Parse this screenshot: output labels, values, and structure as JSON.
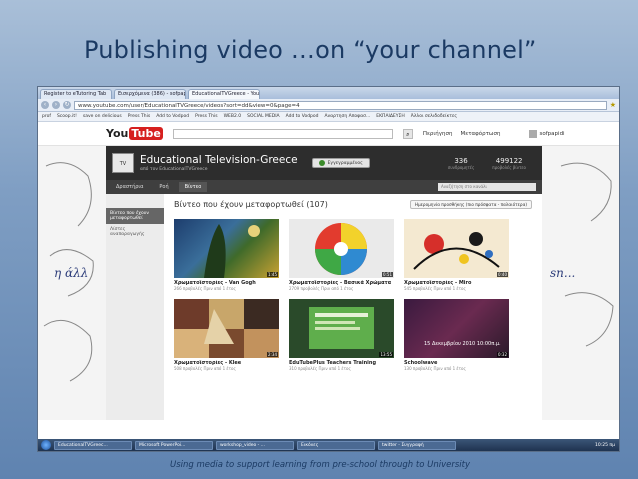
{
  "slide": {
    "title": "Publishing video …on “your channel”",
    "footer": "Using media to support learning from pre-school through to University"
  },
  "browser": {
    "tabs": [
      "Register to eTutoring Tab",
      "Εισερχόμενα (386) - sofpapi",
      "EducationalTVGreece - You"
    ],
    "url": "www.youtube.com/user/EducationalTVGreece/videos?sort=dd&view=0&page=4",
    "bookmarks": [
      "prof",
      "Scoop.it!",
      "save on delicious",
      "Press This",
      "Add to Vodpod",
      "Press This",
      "WEB2.0",
      "SOCIAL MEDIA",
      "Add to Vodpod",
      "Αναρτηση Αποφασ...",
      "ΕΚΠΑΙΔΕΥΣΗ",
      "Άλλοι σελιδοδείκτες"
    ]
  },
  "youtube": {
    "logo_you": "You",
    "logo_tube": "Tube",
    "links": [
      "Περιήγηση",
      "Μεταφόρτωση"
    ],
    "user": "sofpapidi"
  },
  "channel": {
    "name": "Educational Television-Greece",
    "subtitle": "από τον EducationalTVGreece",
    "subscribe_label": "Εγγεγραμμένος",
    "stats": [
      {
        "value": "336",
        "label": "συνδρομητές"
      },
      {
        "value": "499122",
        "label": "προβολές βίντεο"
      }
    ],
    "tabs": [
      "Δραστήρια",
      "Ροή",
      "Βίντεο"
    ],
    "active_tab": "Βίντεο",
    "search_placeholder": "Αναζήτηση στο κανάλι"
  },
  "sidebar": {
    "items": [
      "Βίντεο που έχουν μεταφορτωθεί",
      "Λίστες αναπαραγωγής"
    ]
  },
  "main": {
    "title": "Βίντεο που έχουν μεταφορτωθεί (107)",
    "sort_label": "Ημερομηνία προσθήκης (πιο πρόσφατα - παλαιότερα)"
  },
  "videos": [
    {
      "title": "Χρωματοϊστορίες - Van Gogh",
      "meta": "266 προβολές Πριν από 1 έτος",
      "duration": "1:45"
    },
    {
      "title": "Χρωματοϊστορίες - Βασικά Χρώματα",
      "meta": "2709 προβολές Πριν από 1 έτος",
      "duration": "0:51"
    },
    {
      "title": "Χρωματοϊστορίες - Miro",
      "meta": "545 προβολές Πριν από 1 έτος",
      "duration": "0:40"
    },
    {
      "title": "Χρωματοϊστορίες - Klee",
      "meta": "508 προβολές Πριν από 1 έτος",
      "duration": "2:34"
    },
    {
      "title": "EduTubePlus Teachers Training",
      "meta": "310 προβολές Πριν από 1 έτος",
      "duration": "13:55"
    },
    {
      "title": "Schoolwave",
      "meta": "130 προβολές Πριν από 1 έτος",
      "duration": "0:32",
      "overlay": "15 Δεκεμβρίου 2010 10:00π.μ."
    }
  ],
  "doodles": {
    "left": "η άλλ",
    "right": "sn..."
  },
  "taskbar": {
    "items": [
      "EducationalTVGreec...",
      "Microsoft PowerPoi...",
      "workshop_video - ...",
      "Εικόνες",
      "twitter - Συγγραφή"
    ],
    "clock": "10:25 πμ"
  }
}
